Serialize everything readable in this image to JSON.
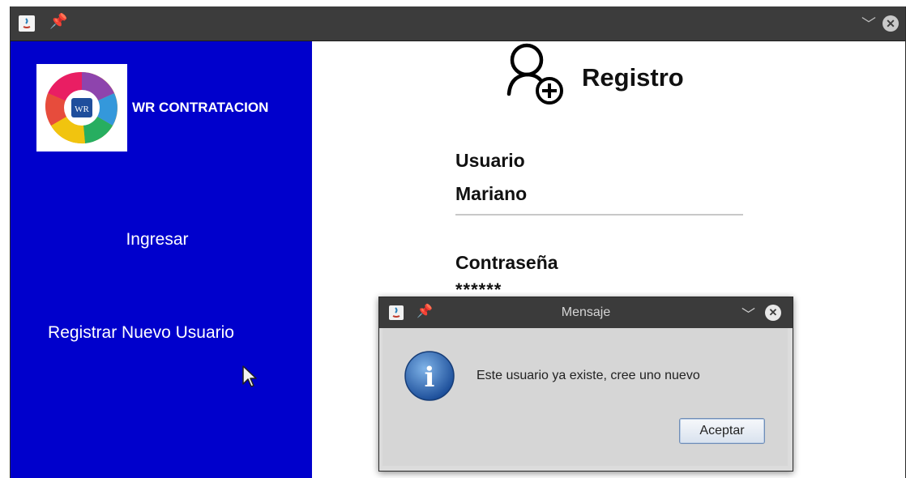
{
  "window": {
    "pin_glyph": "📌",
    "minimize_glyph": "﹀",
    "close_glyph": "✕"
  },
  "sidebar": {
    "brand": "WR CONTRATACION",
    "logo_monogram": "WR",
    "items": [
      {
        "label": "Ingresar"
      },
      {
        "label": "Registrar Nuevo Usuario"
      }
    ],
    "background": "#0000cc"
  },
  "form": {
    "heading": "Registro",
    "username_label": "Usuario",
    "username_value": "Mariano",
    "password_label": "Contraseña",
    "password_value": "******"
  },
  "dialog": {
    "title": "Mensaje",
    "icon_letter": "i",
    "message": "Este usuario ya existe, cree uno nuevo",
    "ok_button": "Aceptar"
  },
  "icons": {
    "heading": "user-add-icon",
    "dialog": "info-icon"
  }
}
